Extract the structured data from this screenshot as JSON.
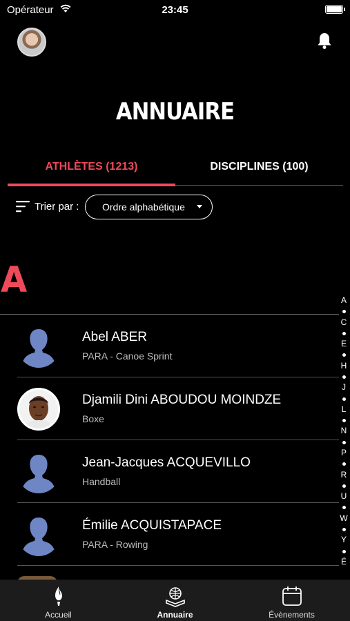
{
  "status_bar": {
    "carrier": "Opérateur",
    "time": "23:45"
  },
  "header": {
    "title": "ANNUAIRE"
  },
  "tabs": [
    {
      "label": "ATHLÈTES (1213)",
      "active": true
    },
    {
      "label": "DISCIPLINES (100)",
      "active": false
    }
  ],
  "sort": {
    "label": "Trier par :",
    "selected": "Ordre alphabétique"
  },
  "section": {
    "letter": "A"
  },
  "athletes": [
    {
      "name": "Abel ABER",
      "discipline": "PARA - Canoe Sprint",
      "photo": "placeholder"
    },
    {
      "name": "Djamili Dini ABOUDOU MOINDZE",
      "discipline": "Boxe",
      "photo": "real"
    },
    {
      "name": "Jean-Jacques ACQUEVILLO",
      "discipline": "Handball",
      "photo": "placeholder"
    },
    {
      "name": "Émilie ACQUISTAPACE",
      "discipline": "PARA - Rowing",
      "photo": "placeholder"
    }
  ],
  "alpha_index": [
    "A",
    "C",
    "E",
    "H",
    "J",
    "L",
    "N",
    "P",
    "R",
    "U",
    "W",
    "Y",
    "É"
  ],
  "tab_bar": {
    "items": [
      {
        "label": "Accueil",
        "icon": "flame-icon",
        "active": false
      },
      {
        "label": "Annuaire",
        "icon": "directory-icon",
        "active": true
      },
      {
        "label": "Évènements",
        "icon": "calendar-icon",
        "active": false
      }
    ]
  },
  "colors": {
    "accent": "#ef4a5a",
    "background": "#000000",
    "placeholder_silhouette": "#6f86c4"
  }
}
